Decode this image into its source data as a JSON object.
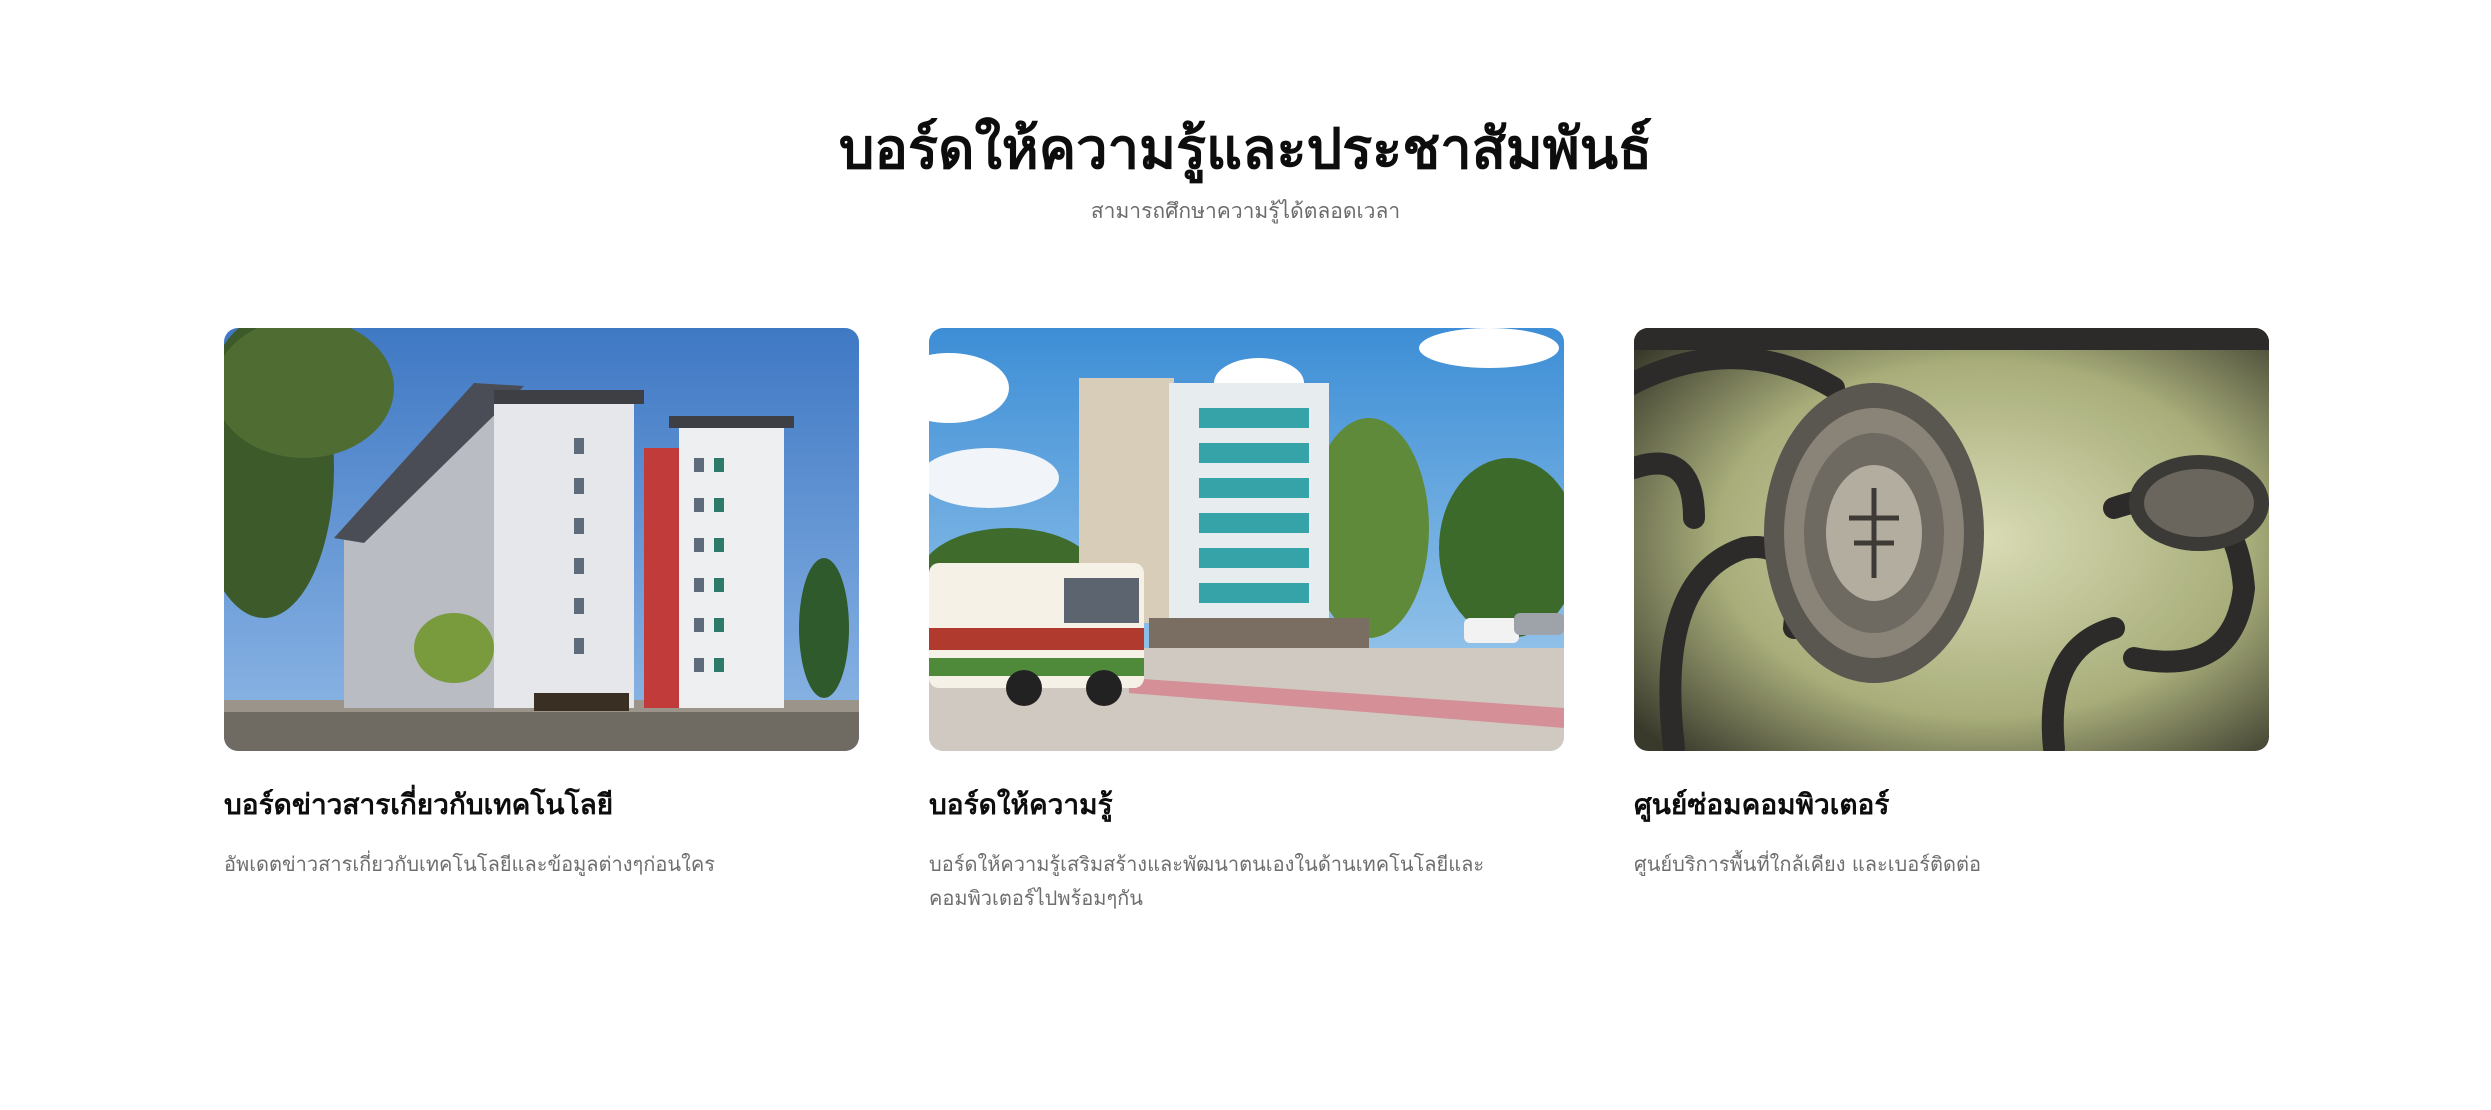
{
  "header": {
    "title": "บอร์ดให้ความรู้และประชาสัมพันธ์",
    "subtitle": "สามารถศึกษาความรู้ได้ตลอดเวลา"
  },
  "cards": [
    {
      "image": "building-photo",
      "title": "บอร์ดข่าวสารเกี่ยวกับเทคโนโลยี",
      "description": "อัพเดตข่าวสารเกี่ยวกับเทคโนโลยีและข้อมูลต่างๆก่อนใคร"
    },
    {
      "image": "campus-bus-photo",
      "title": "บอร์ดให้ความรู้",
      "description": "บอร์ดให้ความรู้เสริมสร้างและพัฒนาตนเองในด้านเทคโนโลยีและคอมพิวเตอร์ไปพร้อมๆกัน"
    },
    {
      "image": "seal-gate-photo",
      "title": "ศูนย์ซ่อมคอมพิวเตอร์",
      "description": "ศูนย์บริการพื้นที่ใกล้เคียง และเบอร์ติดต่อ"
    }
  ]
}
